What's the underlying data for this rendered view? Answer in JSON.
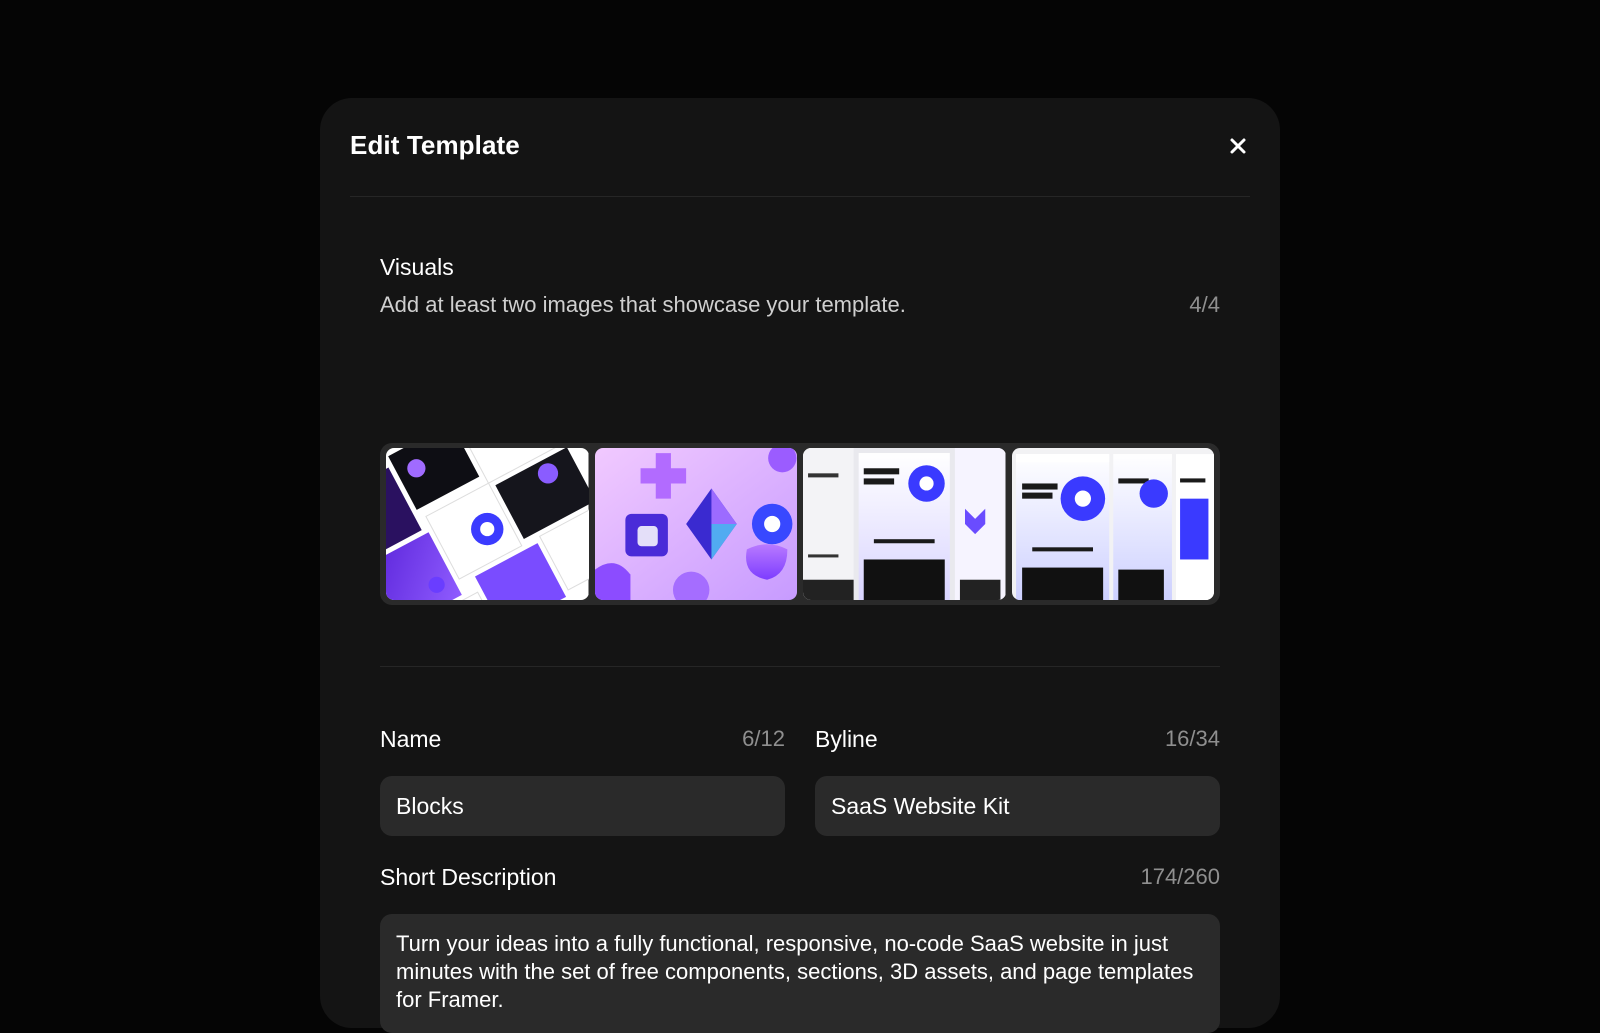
{
  "modal": {
    "title": "Edit Template"
  },
  "visuals": {
    "label": "Visuals",
    "description": "Add at least two images that showcase your template.",
    "counter": "4/4",
    "thumbnails": [
      {
        "alt": "collage-thumbnail"
      },
      {
        "alt": "3d-shapes-thumbnail"
      },
      {
        "alt": "website-pages-thumbnail"
      },
      {
        "alt": "landing-pages-thumbnail"
      }
    ]
  },
  "name": {
    "label": "Name",
    "counter": "6/12",
    "value": "Blocks"
  },
  "byline": {
    "label": "Byline",
    "counter": "16/34",
    "value": "SaaS Website Kit"
  },
  "short_description": {
    "label": "Short Description",
    "counter": "174/260",
    "value": "Turn your ideas into a fully functional, responsive, no-code SaaS website in just minutes with the set of free components, sections, 3D assets, and page templates for Framer."
  },
  "colors": {
    "background": "#050505",
    "modal": "#141414",
    "field": "#2a2a2a",
    "accent": "#7b3dff"
  }
}
